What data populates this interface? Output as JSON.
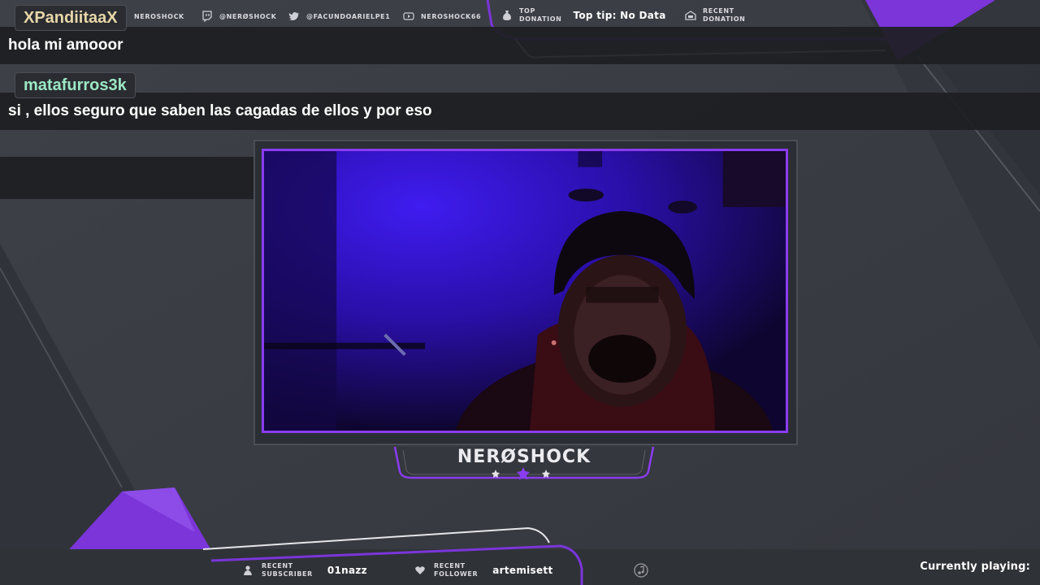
{
  "topbar": {
    "channel": "NEROSHOCK",
    "twitch": "@NERØSHOCK",
    "twitter": "@FACUNDOARIELPE1",
    "youtube": "NEROSHOCK66",
    "top_donation_line1": "TOP",
    "top_donation_line2": "DONATION",
    "top_tip": "Top tip: No Data",
    "recent_donation_line1": "RECENT",
    "recent_donation_line2": "DONATION"
  },
  "chat": [
    {
      "username": "XPandiitaaX",
      "username_color": "#e8d7a8",
      "message": "hola mi amooor"
    },
    {
      "username": "matafurros3k",
      "username_color": "#9be7c4",
      "message": "si , ellos seguro que saben las cagadas de ellos y por eso"
    }
  ],
  "webcam": {
    "streamer_name": "NERØSHOCK"
  },
  "bottombar": {
    "recent_subscriber_line1": "RECENT",
    "recent_subscriber_line2": "SUBSCRIBER",
    "recent_subscriber_value": "01nazz",
    "recent_follower_line1": "RECENT",
    "recent_follower_line2": "FOLLOWER",
    "recent_follower_value": "artemisett",
    "currently_playing": "Currently playing:"
  },
  "colors": {
    "accent": "#8a3cf0",
    "background": "#3a3d44",
    "panel": "#1d1e22"
  },
  "icons": [
    "twitch-icon",
    "twitter-icon",
    "youtube-icon",
    "money-bag-icon",
    "gift-icon",
    "subscriber-icon",
    "heart-icon",
    "music-icon",
    "star-icon"
  ]
}
